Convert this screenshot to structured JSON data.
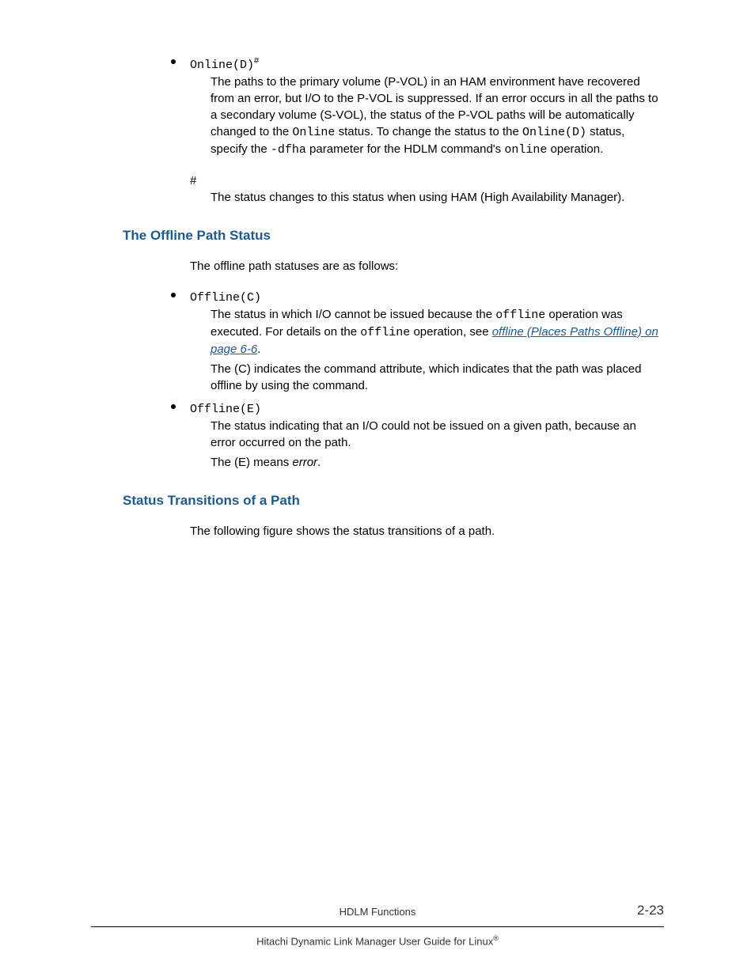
{
  "onlined": {
    "label_code": "Online(D)",
    "sup": "#",
    "para_pre": "The paths to the primary volume (P-VOL) in an HAM environment have recovered from an error, but I/O to the P-VOL is suppressed. If an error occurs in all the paths to a secondary volume (S-VOL), the status of the P-VOL paths will be automatically changed to the ",
    "code1": "Online",
    "para_mid1": " status. To change the status to the ",
    "code2": "Online(D)",
    "para_mid2": " status, specify the ",
    "code3": "-dfha",
    "para_mid3": " parameter for the HDLM command's ",
    "code4": "online",
    "para_end": " operation."
  },
  "hash": {
    "symbol": "#",
    "text": "The status changes to this status when using HAM (High Availability Manager)."
  },
  "offline_heading": "The Offline Path Status",
  "offline_intro": "The offline path statuses are as follows:",
  "offlinec": {
    "label": "Offline(C)",
    "p1_pre": "The status in which I/O cannot be issued because the ",
    "p1_code1": "offline",
    "p1_mid": " operation was executed. For details on the ",
    "p1_code2": "offline",
    "p1_mid2": " operation, see ",
    "p1_link": "offline (Places Paths Offline) on page 6-6",
    "p1_end": ".",
    "p2": "The (C) indicates the command attribute, which indicates that the path was placed offline by using the command."
  },
  "offlinee": {
    "label": "Offline(E)",
    "p1": "The status indicating that an I/O could not be issued on a given path, because an error occurred on the path.",
    "p2_pre": "The (E) means ",
    "p2_italic": "error",
    "p2_end": "."
  },
  "transitions_heading": "Status Transitions of a Path",
  "transitions_intro": "The following figure shows the status transitions of a path.",
  "footer": {
    "section": "HDLM Functions",
    "pagenum": "2-23",
    "title_pre": "Hitachi Dynamic Link Manager User Guide for Linux",
    "reg": "®"
  }
}
